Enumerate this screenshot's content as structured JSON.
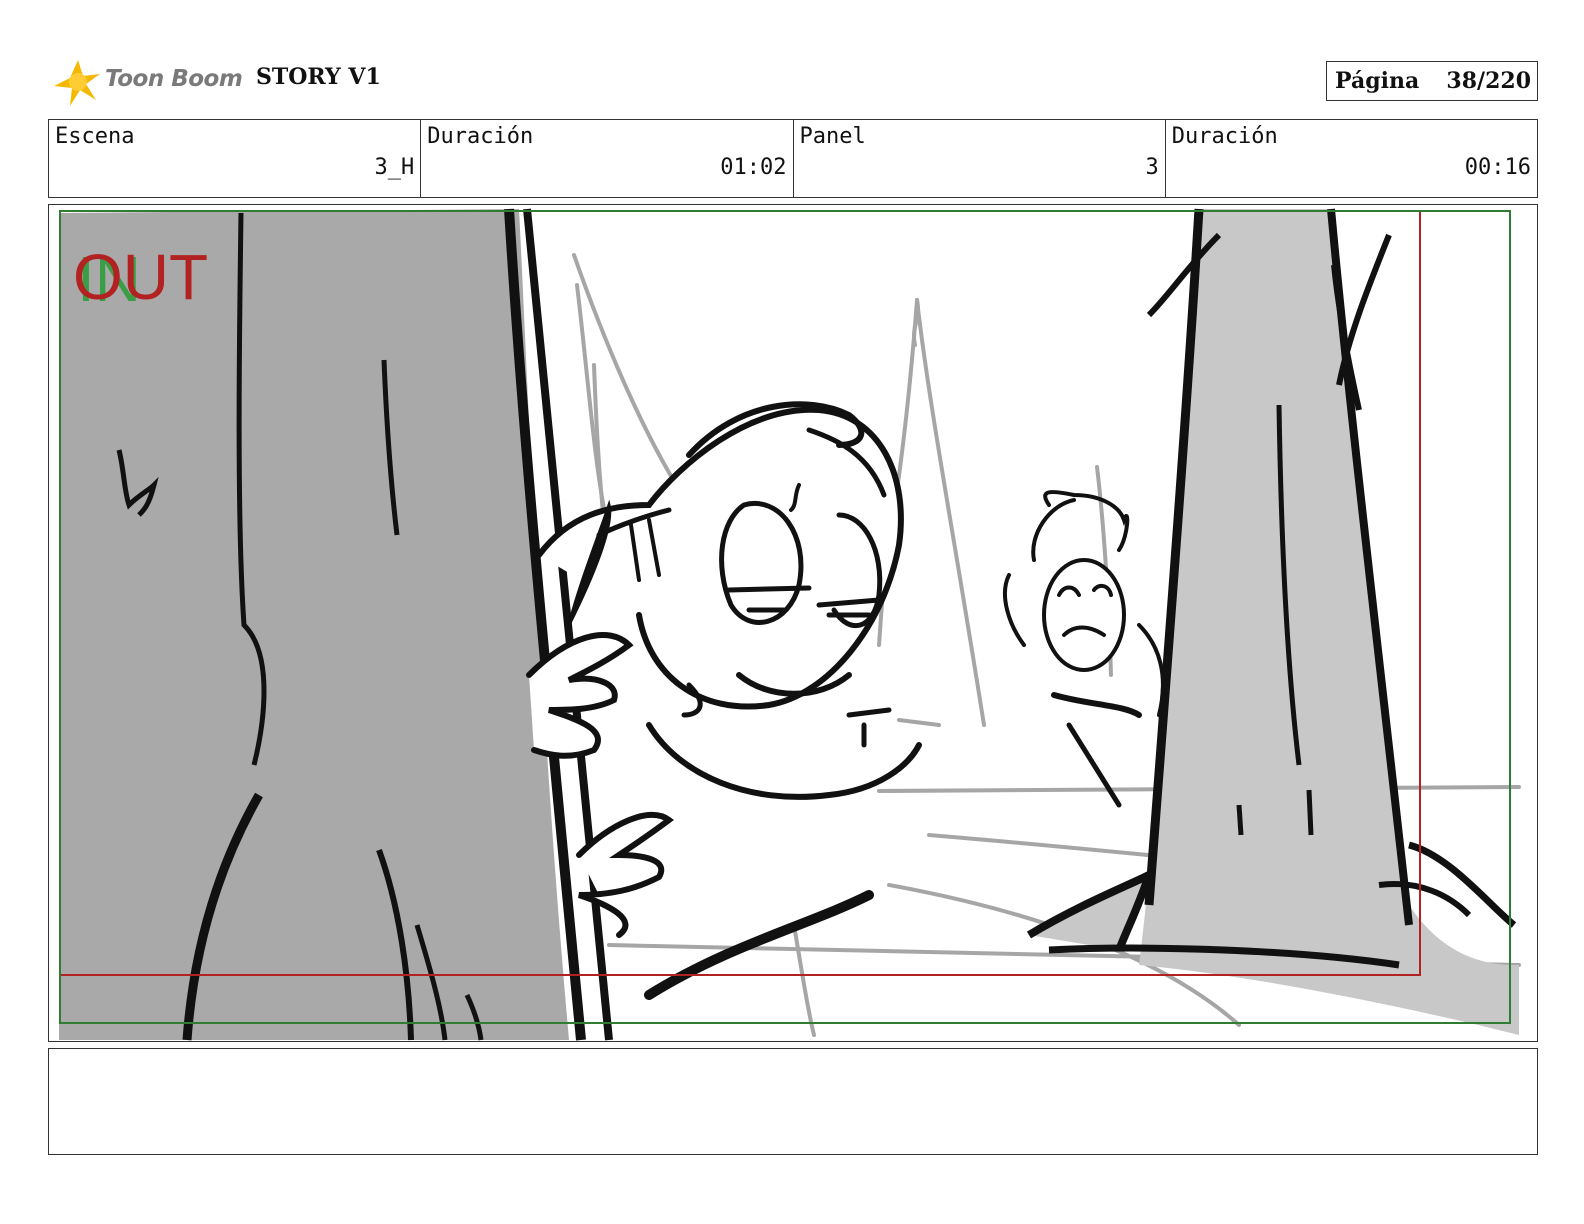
{
  "header": {
    "brand_name": "Toon Boom",
    "project_title": "STORY V1",
    "page_label": "Página",
    "page_number": "38/220"
  },
  "info_fields": [
    {
      "label": "Escena",
      "value": "3_H"
    },
    {
      "label": "Duración",
      "value": "01:02"
    },
    {
      "label": "Panel",
      "value": "3"
    },
    {
      "label": "Duración",
      "value": "00:16"
    }
  ],
  "panel": {
    "in_marker": "IN",
    "out_marker": "OUT",
    "colors": {
      "safe_frame": "#b22222",
      "camera_frame": "#2e7d32",
      "tree_fill": "#a9a9a9",
      "tree_fill_light": "#c8c8c8",
      "sketch_gray": "#a6a6a6",
      "ink": "#111111"
    }
  },
  "caption": {
    "text": ""
  }
}
